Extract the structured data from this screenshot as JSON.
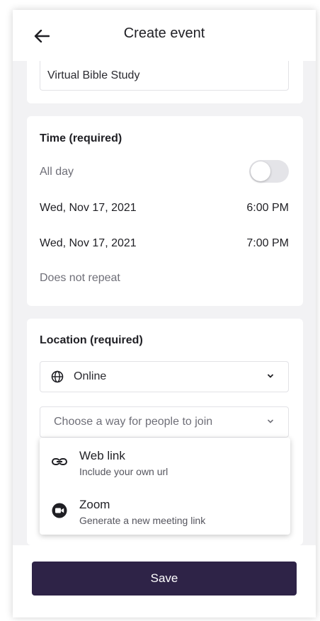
{
  "header": {
    "title": "Create event",
    "back_icon": "arrow-left-icon"
  },
  "event_name": {
    "value": "Virtual Bible Study"
  },
  "time_section": {
    "title": "Time (required)",
    "all_day_label": "All day",
    "all_day_on": false,
    "start_date": "Wed, Nov 17, 2021",
    "start_time": "6:00 PM",
    "end_date": "Wed, Nov 17, 2021",
    "end_time": "7:00 PM",
    "repeat": "Does not repeat"
  },
  "location_section": {
    "title": "Location (required)",
    "type_select": {
      "value": "Online",
      "icon": "globe-icon"
    },
    "join_select": {
      "placeholder": "Choose a way for people to join"
    },
    "options": [
      {
        "label": "Web link",
        "sub": "Include your own url",
        "icon": "link-icon"
      },
      {
        "label": "Zoom",
        "sub": "Generate a new meeting link",
        "icon": "video-camera-icon"
      }
    ]
  },
  "footer": {
    "save_label": "Save"
  },
  "colors": {
    "primary": "#2e2347",
    "background": "#f2f2f4",
    "card": "#ffffff"
  }
}
